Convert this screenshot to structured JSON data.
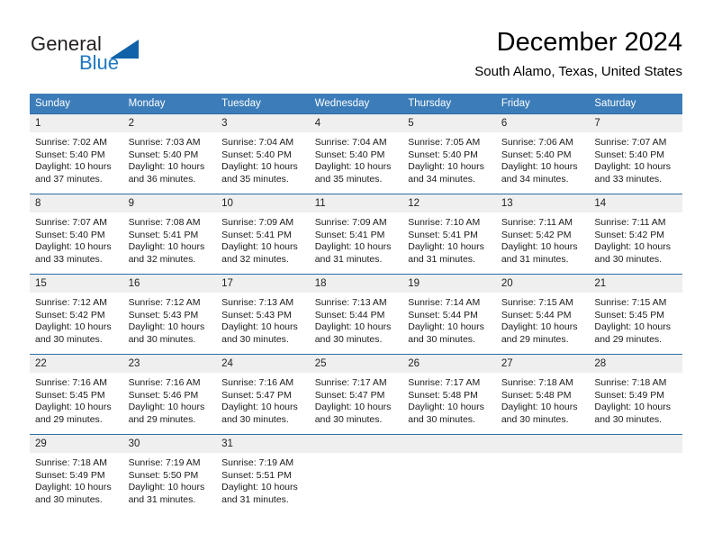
{
  "brand": {
    "word_one": "General",
    "word_two": "Blue",
    "icon": "triangle-logo",
    "colors": {
      "general": "#231f20",
      "blue": "#1f78c1",
      "triangle": "#1063a8"
    }
  },
  "header": {
    "title": "December 2024",
    "subtitle": "South Alamo, Texas, United States"
  },
  "theme": {
    "header_row_bg": "#3b7cb9",
    "daynum_bg": "#efefef",
    "cell_border": "#2e6da4"
  },
  "calendar": {
    "weekday_headers": [
      "Sunday",
      "Monday",
      "Tuesday",
      "Wednesday",
      "Thursday",
      "Friday",
      "Saturday"
    ],
    "weeks": [
      [
        {
          "day": "1",
          "sunrise": "Sunrise: 7:02 AM",
          "sunset": "Sunset: 5:40 PM",
          "daylight_line1": "Daylight: 10 hours",
          "daylight_line2": "and 37 minutes."
        },
        {
          "day": "2",
          "sunrise": "Sunrise: 7:03 AM",
          "sunset": "Sunset: 5:40 PM",
          "daylight_line1": "Daylight: 10 hours",
          "daylight_line2": "and 36 minutes."
        },
        {
          "day": "3",
          "sunrise": "Sunrise: 7:04 AM",
          "sunset": "Sunset: 5:40 PM",
          "daylight_line1": "Daylight: 10 hours",
          "daylight_line2": "and 35 minutes."
        },
        {
          "day": "4",
          "sunrise": "Sunrise: 7:04 AM",
          "sunset": "Sunset: 5:40 PM",
          "daylight_line1": "Daylight: 10 hours",
          "daylight_line2": "and 35 minutes."
        },
        {
          "day": "5",
          "sunrise": "Sunrise: 7:05 AM",
          "sunset": "Sunset: 5:40 PM",
          "daylight_line1": "Daylight: 10 hours",
          "daylight_line2": "and 34 minutes."
        },
        {
          "day": "6",
          "sunrise": "Sunrise: 7:06 AM",
          "sunset": "Sunset: 5:40 PM",
          "daylight_line1": "Daylight: 10 hours",
          "daylight_line2": "and 34 minutes."
        },
        {
          "day": "7",
          "sunrise": "Sunrise: 7:07 AM",
          "sunset": "Sunset: 5:40 PM",
          "daylight_line1": "Daylight: 10 hours",
          "daylight_line2": "and 33 minutes."
        }
      ],
      [
        {
          "day": "8",
          "sunrise": "Sunrise: 7:07 AM",
          "sunset": "Sunset: 5:40 PM",
          "daylight_line1": "Daylight: 10 hours",
          "daylight_line2": "and 33 minutes."
        },
        {
          "day": "9",
          "sunrise": "Sunrise: 7:08 AM",
          "sunset": "Sunset: 5:41 PM",
          "daylight_line1": "Daylight: 10 hours",
          "daylight_line2": "and 32 minutes."
        },
        {
          "day": "10",
          "sunrise": "Sunrise: 7:09 AM",
          "sunset": "Sunset: 5:41 PM",
          "daylight_line1": "Daylight: 10 hours",
          "daylight_line2": "and 32 minutes."
        },
        {
          "day": "11",
          "sunrise": "Sunrise: 7:09 AM",
          "sunset": "Sunset: 5:41 PM",
          "daylight_line1": "Daylight: 10 hours",
          "daylight_line2": "and 31 minutes."
        },
        {
          "day": "12",
          "sunrise": "Sunrise: 7:10 AM",
          "sunset": "Sunset: 5:41 PM",
          "daylight_line1": "Daylight: 10 hours",
          "daylight_line2": "and 31 minutes."
        },
        {
          "day": "13",
          "sunrise": "Sunrise: 7:11 AM",
          "sunset": "Sunset: 5:42 PM",
          "daylight_line1": "Daylight: 10 hours",
          "daylight_line2": "and 31 minutes."
        },
        {
          "day": "14",
          "sunrise": "Sunrise: 7:11 AM",
          "sunset": "Sunset: 5:42 PM",
          "daylight_line1": "Daylight: 10 hours",
          "daylight_line2": "and 30 minutes."
        }
      ],
      [
        {
          "day": "15",
          "sunrise": "Sunrise: 7:12 AM",
          "sunset": "Sunset: 5:42 PM",
          "daylight_line1": "Daylight: 10 hours",
          "daylight_line2": "and 30 minutes."
        },
        {
          "day": "16",
          "sunrise": "Sunrise: 7:12 AM",
          "sunset": "Sunset: 5:43 PM",
          "daylight_line1": "Daylight: 10 hours",
          "daylight_line2": "and 30 minutes."
        },
        {
          "day": "17",
          "sunrise": "Sunrise: 7:13 AM",
          "sunset": "Sunset: 5:43 PM",
          "daylight_line1": "Daylight: 10 hours",
          "daylight_line2": "and 30 minutes."
        },
        {
          "day": "18",
          "sunrise": "Sunrise: 7:13 AM",
          "sunset": "Sunset: 5:44 PM",
          "daylight_line1": "Daylight: 10 hours",
          "daylight_line2": "and 30 minutes."
        },
        {
          "day": "19",
          "sunrise": "Sunrise: 7:14 AM",
          "sunset": "Sunset: 5:44 PM",
          "daylight_line1": "Daylight: 10 hours",
          "daylight_line2": "and 30 minutes."
        },
        {
          "day": "20",
          "sunrise": "Sunrise: 7:15 AM",
          "sunset": "Sunset: 5:44 PM",
          "daylight_line1": "Daylight: 10 hours",
          "daylight_line2": "and 29 minutes."
        },
        {
          "day": "21",
          "sunrise": "Sunrise: 7:15 AM",
          "sunset": "Sunset: 5:45 PM",
          "daylight_line1": "Daylight: 10 hours",
          "daylight_line2": "and 29 minutes."
        }
      ],
      [
        {
          "day": "22",
          "sunrise": "Sunrise: 7:16 AM",
          "sunset": "Sunset: 5:45 PM",
          "daylight_line1": "Daylight: 10 hours",
          "daylight_line2": "and 29 minutes."
        },
        {
          "day": "23",
          "sunrise": "Sunrise: 7:16 AM",
          "sunset": "Sunset: 5:46 PM",
          "daylight_line1": "Daylight: 10 hours",
          "daylight_line2": "and 29 minutes."
        },
        {
          "day": "24",
          "sunrise": "Sunrise: 7:16 AM",
          "sunset": "Sunset: 5:47 PM",
          "daylight_line1": "Daylight: 10 hours",
          "daylight_line2": "and 30 minutes."
        },
        {
          "day": "25",
          "sunrise": "Sunrise: 7:17 AM",
          "sunset": "Sunset: 5:47 PM",
          "daylight_line1": "Daylight: 10 hours",
          "daylight_line2": "and 30 minutes."
        },
        {
          "day": "26",
          "sunrise": "Sunrise: 7:17 AM",
          "sunset": "Sunset: 5:48 PM",
          "daylight_line1": "Daylight: 10 hours",
          "daylight_line2": "and 30 minutes."
        },
        {
          "day": "27",
          "sunrise": "Sunrise: 7:18 AM",
          "sunset": "Sunset: 5:48 PM",
          "daylight_line1": "Daylight: 10 hours",
          "daylight_line2": "and 30 minutes."
        },
        {
          "day": "28",
          "sunrise": "Sunrise: 7:18 AM",
          "sunset": "Sunset: 5:49 PM",
          "daylight_line1": "Daylight: 10 hours",
          "daylight_line2": "and 30 minutes."
        }
      ],
      [
        {
          "day": "29",
          "sunrise": "Sunrise: 7:18 AM",
          "sunset": "Sunset: 5:49 PM",
          "daylight_line1": "Daylight: 10 hours",
          "daylight_line2": "and 30 minutes."
        },
        {
          "day": "30",
          "sunrise": "Sunrise: 7:19 AM",
          "sunset": "Sunset: 5:50 PM",
          "daylight_line1": "Daylight: 10 hours",
          "daylight_line2": "and 31 minutes."
        },
        {
          "day": "31",
          "sunrise": "Sunrise: 7:19 AM",
          "sunset": "Sunset: 5:51 PM",
          "daylight_line1": "Daylight: 10 hours",
          "daylight_line2": "and 31 minutes."
        },
        {
          "day": "",
          "sunrise": "",
          "sunset": "",
          "daylight_line1": "",
          "daylight_line2": ""
        },
        {
          "day": "",
          "sunrise": "",
          "sunset": "",
          "daylight_line1": "",
          "daylight_line2": ""
        },
        {
          "day": "",
          "sunrise": "",
          "sunset": "",
          "daylight_line1": "",
          "daylight_line2": ""
        },
        {
          "day": "",
          "sunrise": "",
          "sunset": "",
          "daylight_line1": "",
          "daylight_line2": ""
        }
      ]
    ]
  }
}
